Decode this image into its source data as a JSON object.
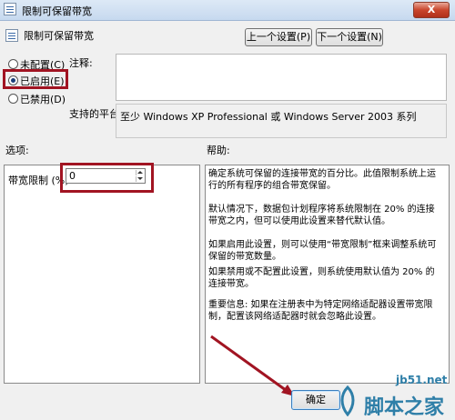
{
  "window": {
    "title": "限制可保留带宽",
    "close_label": "X"
  },
  "header": {
    "title": "限制可保留带宽"
  },
  "nav": {
    "prev_label": "上一个设置(P)",
    "next_label": "下一个设置(N)"
  },
  "state_options": [
    {
      "label": "未配置(C)",
      "selected": false
    },
    {
      "label": "已启用(E)",
      "selected": true
    },
    {
      "label": "已禁用(D)",
      "selected": false
    }
  ],
  "comment": {
    "label": "注释:",
    "value": ""
  },
  "platform": {
    "label": "支持的平台:",
    "value": "至少 Windows XP Professional 或 Windows Server 2003 系列"
  },
  "options": {
    "label": "选项:",
    "bandwidth_label": "带宽限制 (%):",
    "bandwidth_value": "0"
  },
  "help": {
    "label": "帮助:",
    "paragraphs": [
      "确定系统可保留的连接带宽的百分比。此值限制系统上运行的所有程序的组合带宽保留。",
      "默认情况下，数据包计划程序将系统限制在 20% 的连接带宽之内，但可以使用此设置来替代默认值。",
      "如果启用此设置，则可以使用“带宽限制”框来调整系统可保留的带宽数量。",
      "如果禁用或不配置此设置，则系统使用默认值为 20% 的连接带宽。",
      "重要信息: 如果在注册表中为特定网络适配器设置带宽限制，配置该网络适配器时就会忽略此设置。"
    ]
  },
  "footer": {
    "ok_label": "确定"
  },
  "watermark": {
    "url": "jb51.net",
    "site": "脚本之家"
  },
  "colors": {
    "highlight": "#a11422",
    "arrow": "#a11422",
    "watermark": "#2f7fa8"
  }
}
